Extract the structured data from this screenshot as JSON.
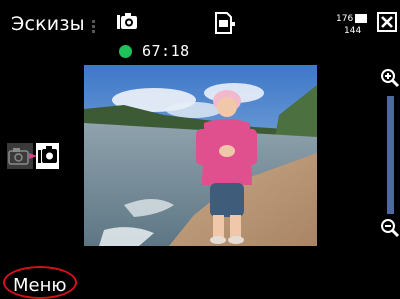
{
  "header": {
    "title": "Эскизы",
    "icons": [
      "status-dots-icon",
      "video-camera-icon",
      "memory-card-icon",
      "resolution-icon",
      "close-icon"
    ],
    "resolution_top": "176",
    "resolution_bottom": "144"
  },
  "recording": {
    "status_color": "#1fc25a",
    "time": "67:18"
  },
  "viewfinder": {
    "image": "live preview: child in pink hoodie walking on sandy beach by water"
  },
  "mode_switch": {
    "icons": [
      "photo-camera-icon",
      "video-camera-icon"
    ],
    "active": "video"
  },
  "zoom": {
    "icons": [
      "zoom-in-icon",
      "zoom-out-icon"
    ],
    "track_color": "#4f69a3"
  },
  "softkeys": {
    "left": "Меню",
    "highlight_color": "#d4101a"
  }
}
